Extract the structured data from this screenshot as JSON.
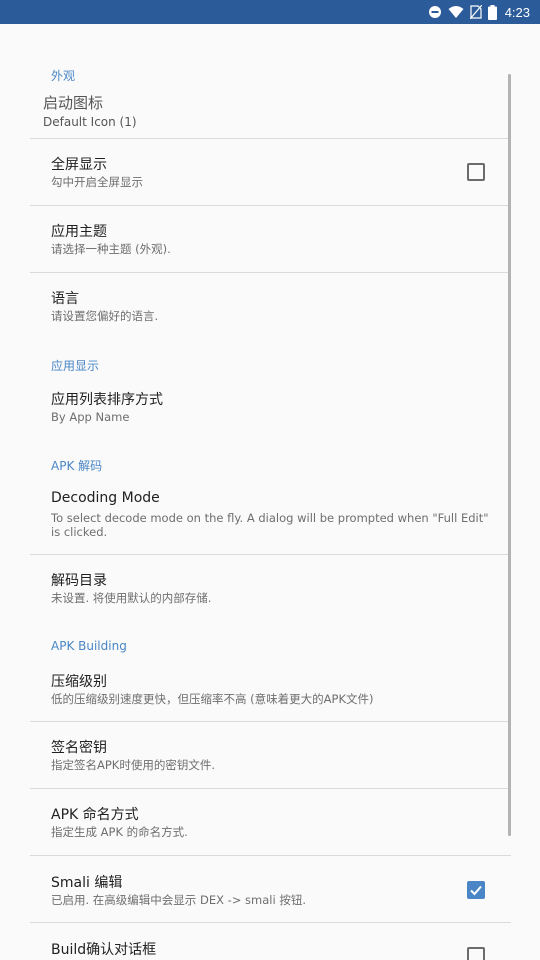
{
  "status_bar": {
    "time": "4:23"
  },
  "sections": {
    "appearance": {
      "header": "外观",
      "launcher_icon": {
        "title": "启动图标",
        "summary": "Default Icon (1)"
      },
      "fullscreen": {
        "title": "全屏显示",
        "summary": "勾中开启全屏显示",
        "checked": false
      },
      "theme": {
        "title": "应用主题",
        "summary": "请选择一种主题 (外观)."
      },
      "language": {
        "title": "语言",
        "summary": "请设置您偏好的语言."
      }
    },
    "app_display": {
      "header": "应用显示",
      "sort": {
        "title": "应用列表排序方式",
        "summary": "By App Name"
      }
    },
    "apk_decode": {
      "header": "APK 解码",
      "decoding_mode": {
        "title": "Decoding Mode",
        "summary": "To select decode mode on the fly. A dialog will be prompted when \"Full Edit\" is clicked."
      },
      "decode_dir": {
        "title": "解码目录",
        "summary": "未设置. 将使用默认的内部存储."
      }
    },
    "apk_building": {
      "header": "APK Building",
      "compression": {
        "title": "压缩级别",
        "summary": "低的压缩级别速度更快，但压缩率不高 (意味着更大的APK文件)"
      },
      "signing_key": {
        "title": "签名密钥",
        "summary": "指定签名APK时使用的密钥文件."
      },
      "apk_naming": {
        "title": "APK 命名方式",
        "summary": "指定生成 APK 的命名方式."
      },
      "smali_edit": {
        "title": "Smali 编辑",
        "summary": "已启用. 在高级编辑中会显示 DEX -> smali 按钮.",
        "checked": true
      },
      "build_confirm": {
        "title": "Build确认对话框",
        "checked": false
      }
    }
  },
  "colors": {
    "status_bar": "#2c5b9a",
    "accent": "#4a86c5",
    "background": "#fafafa"
  }
}
